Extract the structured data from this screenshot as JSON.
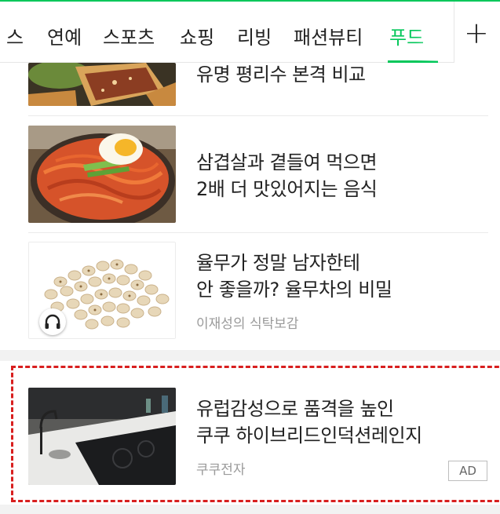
{
  "tabs": [
    {
      "label": "스",
      "active": false
    },
    {
      "label": "연예",
      "active": false
    },
    {
      "label": "스포츠",
      "active": false
    },
    {
      "label": "쇼핑",
      "active": false
    },
    {
      "label": "리빙",
      "active": false
    },
    {
      "label": "패션뷰티",
      "active": false
    },
    {
      "label": "푸드",
      "active": true
    }
  ],
  "add_tab": {
    "label": "+"
  },
  "colors": {
    "accent": "#03c75a",
    "ad_outline": "#d81f1f",
    "source_gray": "#9a9a9a"
  },
  "articles": [
    {
      "title": "유명 평리수 본격 비교",
      "source": "",
      "thumb": "pastry-image"
    },
    {
      "title": "삼겹살과 곁들여 먹으면\n2배 더 맛있어지는 음식",
      "source": "",
      "thumb": "spicy-noodles-image"
    },
    {
      "title": "율무가 정말 남자한테\n안 좋을까? 율무차의 비밀",
      "source": "이재성의 식탁보감",
      "thumb": "job-tears-image",
      "icon": "headphones-icon"
    }
  ],
  "ad": {
    "title": "유럽감성으로 품격을 높인\n쿠쿠 하이브리드인덕션레인지",
    "source": "쿠쿠전자",
    "badge": "AD",
    "thumb": "induction-kitchen-image"
  }
}
